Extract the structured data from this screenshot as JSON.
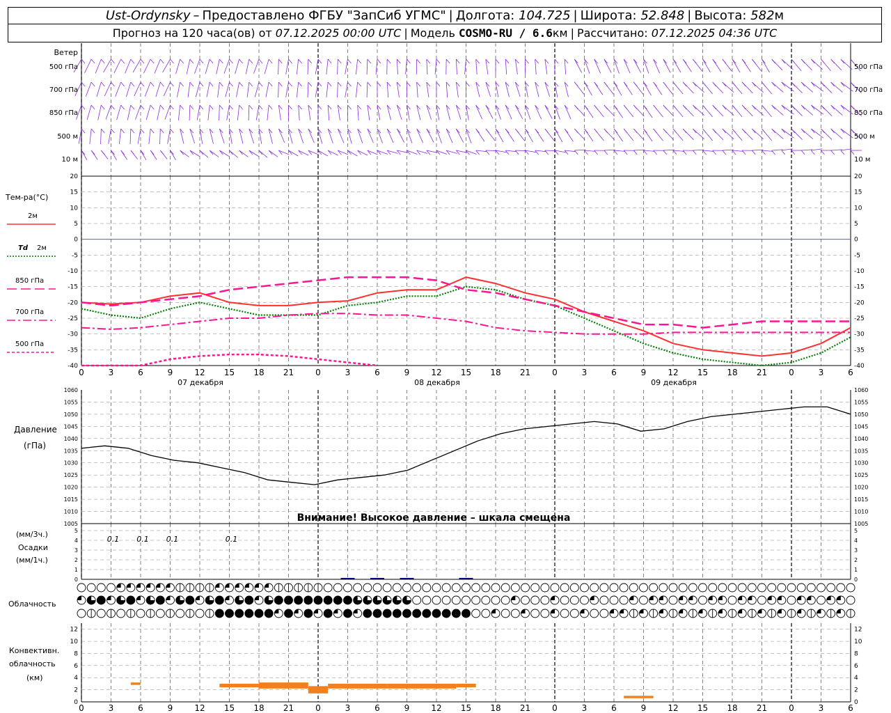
{
  "header": {
    "station": "Ust-Ordynsky",
    "dash": "–",
    "provider": "Предоставлено ФГБУ \"ЗапСиб УГМС\"",
    "lon_label": "Долгота:",
    "lon_value": "104.725",
    "lat_label": "Широта:",
    "lat_value": "52.848",
    "alt_label": "Высота:",
    "alt_value": "582",
    "alt_unit": "м",
    "sep": "|",
    "forecast_label": "Прогноз на 120 часа(ов) от",
    "forecast_start": "07.12.2025 00:00 UTC",
    "model_label": "Модель",
    "model_name": "COSMO-RU / 6.6",
    "model_unit": "км",
    "computed_label": "Рассчитано:",
    "computed_value": "07.12.2025 04:36 UTC"
  },
  "wind_panel": {
    "title": "Ветер",
    "levels": [
      "500 гПа",
      "700 гПа",
      "850 гПа",
      "500 м",
      "10 м"
    ]
  },
  "temp_panel": {
    "title": "Тем-ра(°C)",
    "legend": [
      {
        "label": "2м",
        "color": "#ff3030",
        "style": "solid"
      },
      {
        "label_italic": "Td",
        "label": "2м",
        "color": "#008000",
        "style": "dotted"
      },
      {
        "label": "850 гПа",
        "color": "#ff1493",
        "style": "longdash"
      },
      {
        "label": "700 гПа",
        "color": "#ff1493",
        "style": "dashdot"
      },
      {
        "label": "500 гПа",
        "color": "#ff1493",
        "style": "shortdash"
      }
    ],
    "dates": [
      "07 декабря",
      "08 декабря",
      "09 декабря"
    ]
  },
  "pressure_panel": {
    "title": "Давление",
    "unit": "(гПа)",
    "warning": "Внимание! Высокое давление – шкала смещена"
  },
  "precip_panel": {
    "unit_3h": "(мм/3ч.)",
    "title": "Осадки",
    "unit_1h": "(мм/1ч.)",
    "labels": [
      {
        "text": "0.1",
        "hour": 3
      },
      {
        "text": "0.1",
        "hour": 6
      },
      {
        "text": "0.1",
        "hour": 9
      },
      {
        "text": "0.1",
        "hour": 15
      }
    ]
  },
  "cloud_panel": {
    "title": "Облачность"
  },
  "conv_panel": {
    "title_1": "Конвективн.",
    "title_2": "облачность",
    "unit": "(км)"
  },
  "colors": {
    "wind": "#8a2be2",
    "temp2m": "#ff3030",
    "td2m": "#008000",
    "upper": "#ff1493",
    "zero_line": "#4060ff",
    "pressure": "#000000",
    "precip": "#000080",
    "convective": "#f08020"
  },
  "chart_data": [
    {
      "type": "line",
      "name": "temperature",
      "x_unit": "hours since 07.12.2025 00:00 UTC",
      "xticks": [
        "0",
        "3",
        "6",
        "9",
        "12",
        "15",
        "18",
        "21",
        "0",
        "3",
        "6",
        "9",
        "12",
        "15",
        "18",
        "21",
        "0",
        "3",
        "6",
        "9",
        "12",
        "15",
        "18",
        "21",
        "0",
        "3",
        "6"
      ],
      "ylim": [
        -40,
        20
      ],
      "yticks": [
        20,
        15,
        10,
        5,
        0,
        -5,
        -10,
        -15,
        -20,
        -25,
        -30,
        -35,
        -40
      ],
      "series": [
        {
          "name": "2м",
          "x": [
            0,
            3,
            6,
            9,
            12,
            15,
            18,
            21,
            24,
            27,
            30,
            33,
            36,
            39,
            42,
            45,
            48,
            51,
            54,
            57,
            60,
            63,
            66,
            69,
            72,
            75,
            78
          ],
          "values": [
            -20,
            -20.5,
            -20,
            -18,
            -17,
            -20,
            -21,
            -21,
            -20,
            -19.5,
            -17,
            -16,
            -16,
            -12,
            -14,
            -17,
            -19,
            -23,
            -26,
            -29,
            -33,
            -35,
            -36,
            -37,
            -36,
            -33,
            -28
          ]
        },
        {
          "name": "Td 2м",
          "x": [
            0,
            3,
            6,
            9,
            12,
            15,
            18,
            21,
            24,
            27,
            30,
            33,
            36,
            39,
            42,
            45,
            48,
            51,
            54,
            57,
            60,
            63,
            66,
            69,
            72,
            75,
            78
          ],
          "values": [
            -22,
            -24,
            -25,
            -22,
            -20,
            -22,
            -24,
            -24,
            -24,
            -21,
            -20,
            -18,
            -18,
            -15,
            -16,
            -19,
            -21,
            -25,
            -29,
            -33,
            -36,
            -38,
            -39,
            -40,
            -39,
            -36,
            -31
          ]
        },
        {
          "name": "850 гПа",
          "x": [
            0,
            3,
            6,
            9,
            12,
            15,
            18,
            21,
            24,
            27,
            30,
            33,
            36,
            39,
            42,
            45,
            48,
            51,
            54,
            57,
            60,
            63,
            66,
            69,
            72,
            75,
            78
          ],
          "values": [
            -20,
            -21,
            -20,
            -19,
            -18,
            -16,
            -15,
            -14,
            -13,
            -12,
            -12,
            -12,
            -13,
            -16,
            -17,
            -19,
            -21,
            -23,
            -25,
            -27,
            -27,
            -28,
            -27,
            -26,
            -26,
            -26,
            -26
          ]
        },
        {
          "name": "700 гПа",
          "x": [
            0,
            3,
            6,
            9,
            12,
            15,
            18,
            21,
            24,
            27,
            30,
            33,
            36,
            39,
            42,
            45,
            48,
            51,
            54,
            57,
            60,
            63,
            66,
            69,
            72,
            75,
            78
          ],
          "values": [
            -28,
            -28.5,
            -28,
            -27,
            -26,
            -25,
            -25,
            -24,
            -23.5,
            -23.5,
            -24,
            -24,
            -25,
            -26,
            -28,
            -29,
            -29.5,
            -30,
            -30,
            -30,
            -29.5,
            -29.5,
            -29.5,
            -29.5,
            -29.5,
            -29.5,
            -29.5
          ]
        },
        {
          "name": "500 гПа",
          "x": [
            0,
            3,
            6,
            9,
            12,
            15,
            18,
            21,
            24,
            27,
            30
          ],
          "values": [
            -42,
            -41,
            -40,
            -38,
            -37,
            -36.5,
            -36.5,
            -37,
            -38,
            -39,
            -40
          ]
        }
      ],
      "dates": [
        "07 декабря",
        "08 декабря",
        "09 декабря"
      ]
    },
    {
      "type": "line",
      "name": "pressure",
      "ylim": [
        1005,
        1060
      ],
      "yticks": [
        1060,
        1055,
        1050,
        1045,
        1040,
        1035,
        1030,
        1025,
        1020,
        1015,
        1010,
        1005
      ],
      "x": [
        0,
        3,
        6,
        9,
        12,
        15,
        18,
        21,
        24,
        27,
        30,
        33,
        36,
        39,
        42,
        45,
        48,
        51,
        54,
        57,
        60,
        63,
        66,
        69,
        72,
        75,
        78
      ],
      "values": [
        1036,
        1037,
        1036,
        1033,
        1031,
        1030,
        1028,
        1026,
        1023,
        1022,
        1021,
        1023,
        1024,
        1025,
        1027,
        1031,
        1035,
        1039,
        1042,
        1044,
        1045,
        1046,
        1047,
        1046,
        1043,
        1044,
        1047,
        1049,
        1050,
        1051,
        1052,
        1053,
        1053,
        1050
      ],
      "title": "Давление"
    },
    {
      "type": "bar",
      "name": "precipitation",
      "ylim": [
        0,
        5
      ],
      "yticks": [
        5,
        4,
        3,
        2,
        1,
        0
      ],
      "x": [
        27,
        30,
        33,
        39
      ],
      "values": [
        0.1,
        0.1,
        0.1,
        0.1
      ]
    },
    {
      "type": "bar",
      "name": "convective cloud",
      "ylim": [
        0,
        13
      ],
      "yticks": [
        12,
        10,
        8,
        6,
        4,
        2,
        0
      ],
      "segments": [
        {
          "x0": 5,
          "x1": 6,
          "bottom": 2.8,
          "top": 3.2
        },
        {
          "x0": 14,
          "x1": 18,
          "bottom": 2.4,
          "top": 3.0
        },
        {
          "x0": 18,
          "x1": 23,
          "bottom": 2.2,
          "top": 3.2
        },
        {
          "x0": 23,
          "x1": 25,
          "bottom": 1.4,
          "top": 2.6
        },
        {
          "x0": 25,
          "x1": 31,
          "bottom": 2.2,
          "top": 3.0
        },
        {
          "x0": 31,
          "x1": 38,
          "bottom": 2.2,
          "top": 3.0
        },
        {
          "x0": 38,
          "x1": 40,
          "bottom": 2.4,
          "top": 3.0
        },
        {
          "x0": 55,
          "x1": 58,
          "bottom": 0.6,
          "top": 1.0
        }
      ]
    }
  ]
}
